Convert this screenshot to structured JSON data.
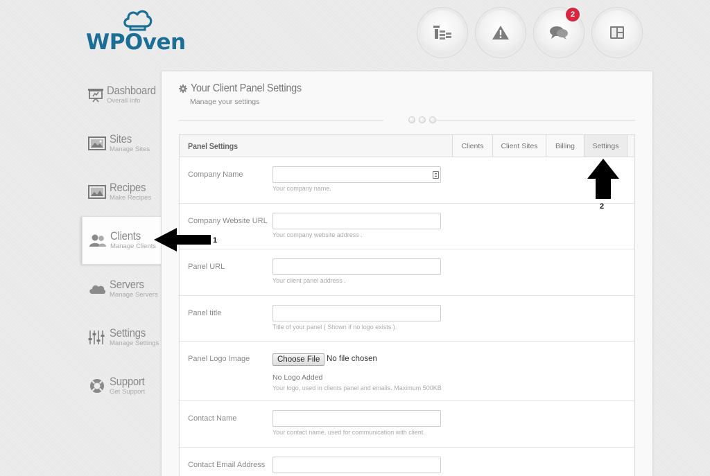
{
  "brand": {
    "name": "WPOven",
    "color": "#1b6e96"
  },
  "top_icons": [
    {
      "name": "stats-icon",
      "badge": null
    },
    {
      "name": "warning-icon",
      "badge": null
    },
    {
      "name": "chat-icon",
      "badge": "2"
    },
    {
      "name": "layout-icon",
      "badge": null
    }
  ],
  "sidebar": {
    "items": [
      {
        "title": "Dashboard",
        "subtitle": "Overall Info",
        "icon": "presentation-icon",
        "active": false
      },
      {
        "title": "Sites",
        "subtitle": "Manage Sites",
        "icon": "image-icon",
        "active": false
      },
      {
        "title": "Recipes",
        "subtitle": "Make Recipes",
        "icon": "recipe-image-icon",
        "active": false
      },
      {
        "title": "Clients",
        "subtitle": "Manage Clients",
        "icon": "users-icon",
        "active": true
      },
      {
        "title": "Servers",
        "subtitle": "Manage Servers",
        "icon": "cloud-icon",
        "active": false
      },
      {
        "title": "Settings",
        "subtitle": "Manage Settings",
        "icon": "sliders-icon",
        "active": false
      },
      {
        "title": "Support",
        "subtitle": "Get Support",
        "icon": "lifebuoy-icon",
        "active": false
      }
    ]
  },
  "panel": {
    "title": "Your Client Panel Settings",
    "subtitle": "Manage your settings",
    "box_title": "Panel Settings",
    "tabs": [
      {
        "label": "Clients",
        "active": false
      },
      {
        "label": "Client Sites",
        "active": false
      },
      {
        "label": "Billing",
        "active": false
      },
      {
        "label": "Settings",
        "active": true
      }
    ],
    "fields": {
      "company_name": {
        "label": "Company Name",
        "value": "",
        "help": "Your company name."
      },
      "company_website": {
        "label": "Company Website URL",
        "value": "",
        "help": "Your company website address ."
      },
      "panel_url": {
        "label": "Panel URL",
        "value": "",
        "help": "Your client panel address ."
      },
      "panel_title": {
        "label": "Panel title",
        "value": "",
        "help": "Title of your panel ( Shown if no logo exists )."
      },
      "panel_logo": {
        "label": "Panel Logo Image",
        "button": "Choose File",
        "status": "No file chosen",
        "no_logo": "No Logo Added",
        "help": "Your logo, used in clients panel and emails. Maximum 500KB"
      },
      "contact_name": {
        "label": "Contact Name",
        "value": "",
        "help": "Your contact name, used for communication with client."
      },
      "contact_email": {
        "label": "Contact Email Address",
        "value": ""
      }
    }
  },
  "annotations": [
    {
      "label": "1",
      "direction": "left"
    },
    {
      "label": "2",
      "direction": "up"
    }
  ]
}
